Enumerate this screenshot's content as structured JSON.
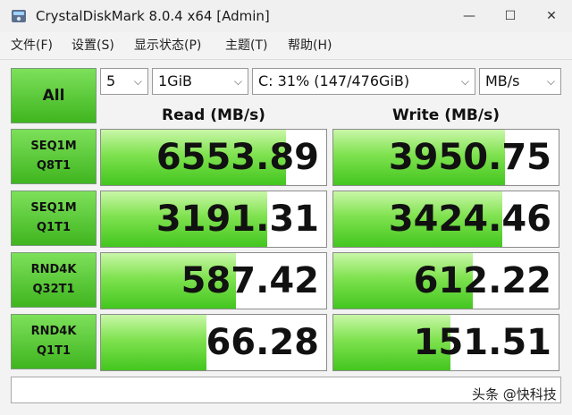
{
  "window": {
    "title": "CrystalDiskMark 8.0.4 x64 [Admin]",
    "minimize_glyph": "—",
    "maximize_glyph": "☐",
    "close_glyph": "✕"
  },
  "menu": [
    {
      "label": "文件(F)"
    },
    {
      "label": "设置(S)"
    },
    {
      "label": "显示状态(P)"
    },
    {
      "label": "主题(T)"
    },
    {
      "label": "帮助(H)"
    }
  ],
  "controls": {
    "all_label": "All",
    "count": "5",
    "size": "1GiB",
    "drive": "C: 31% (147/476GiB)",
    "unit": "MB/s",
    "chevron": "⌵"
  },
  "headers": {
    "read": "Read (MB/s)",
    "write": "Write (MB/s)"
  },
  "tests": [
    {
      "line1": "SEQ1M",
      "line2": "Q8T1",
      "read": "6553.89",
      "write": "3950.75",
      "read_fill": 0.82,
      "write_fill": 0.76
    },
    {
      "line1": "SEQ1M",
      "line2": "Q1T1",
      "read": "3191.31",
      "write": "3424.46",
      "read_fill": 0.74,
      "write_fill": 0.75
    },
    {
      "line1": "RND4K",
      "line2": "Q32T1",
      "read": "587.42",
      "write": "612.22",
      "read_fill": 0.6,
      "write_fill": 0.62
    },
    {
      "line1": "RND4K",
      "line2": "Q1T1",
      "read": "66.28",
      "write": "151.51",
      "read_fill": 0.47,
      "write_fill": 0.52
    }
  ],
  "status": "",
  "watermark": "头条 @快科技",
  "colors": {
    "accent_green": "#4cc324",
    "bar_light": "#c9f7a8"
  }
}
